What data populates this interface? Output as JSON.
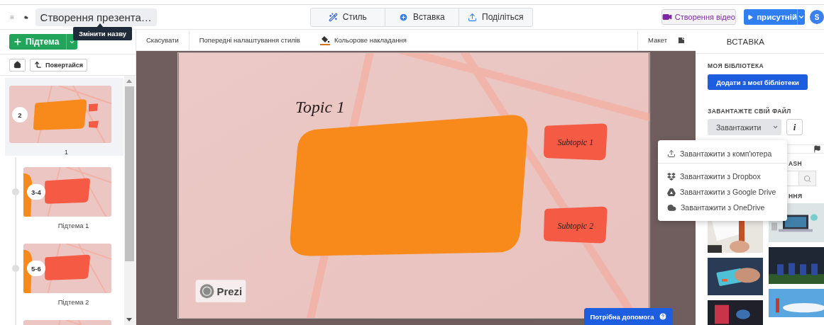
{
  "header": {
    "title": "Створення презента…",
    "tooltip": "Змінити назву",
    "tabs": [
      {
        "label": "Стиль",
        "kind": "style"
      },
      {
        "label": "Вставка",
        "kind": "insert"
      },
      {
        "label": "Поділіться",
        "kind": "share"
      }
    ],
    "video_button": "Створення відео",
    "present_button": "присутній",
    "avatar": "S"
  },
  "left": {
    "add_button": "Підтема",
    "back_button": "Повертайся",
    "slides": [
      {
        "kind": "topic",
        "badge": "2",
        "label": "1",
        "selected": true
      },
      {
        "kind": "subtopic",
        "badge": "3-4",
        "label": "Підтема 1",
        "selected": false
      },
      {
        "kind": "subtopic",
        "badge": "5-6",
        "label": "Підтема 2",
        "selected": false
      },
      {
        "kind": "subtopic",
        "selected": false
      }
    ]
  },
  "toolbar": {
    "undo": "Скасувати",
    "style_presets": "Попередні налаштування стилів",
    "color_overlay": "Кольорове накладання",
    "layout": "Макет"
  },
  "slide": {
    "topic": "Topic 1",
    "subtopics": [
      "Subtopic 1",
      "Subtopic 2"
    ],
    "logo": "Prezi"
  },
  "help_button": "Потрібна допомога",
  "insert_panel": {
    "title": "ВСТАВКА",
    "library_heading": "МОЯ БІБЛІОТЕКА",
    "library_button": "Додати з моєї бібліотеки",
    "upload_heading": "ЗАВАНТАЖТЕ СВІЙ ФАЙЛ",
    "upload_button": "Завантажити",
    "info_button": "i",
    "upload_menu": [
      {
        "label": "Завантажити з комп'ютера",
        "kind": "computer"
      },
      {
        "label": "Завантажити з Dropbox",
        "kind": "dropbox"
      },
      {
        "label": "Завантажити з Google Drive",
        "kind": "drive"
      },
      {
        "label": "Завантажити з OneDrive",
        "kind": "onedrive"
      }
    ],
    "source_heading": "ASH",
    "photos_heading": "ННЯ"
  }
}
